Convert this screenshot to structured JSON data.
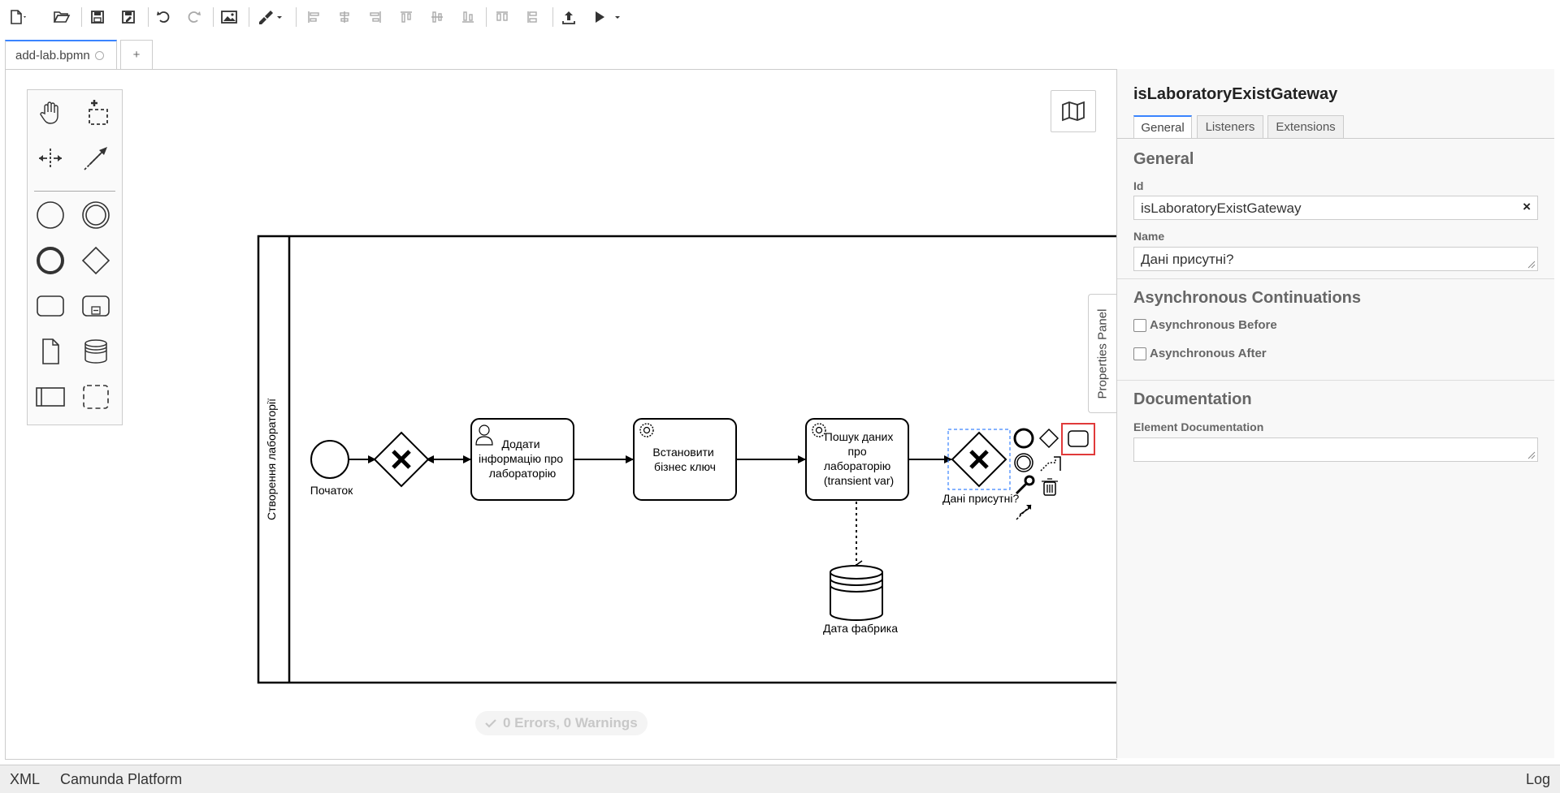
{
  "tabs": {
    "file_tab": "add-lab.bpmn",
    "add_tab": "+"
  },
  "diagram": {
    "pool_label": "Створення лабораторії",
    "start_event": "Початок",
    "task1": [
      "Додати",
      "інформацію про",
      "лабораторію"
    ],
    "task2": [
      "Встановити",
      "бізнес ключ"
    ],
    "task3": [
      "Пошук даних",
      "про",
      "лабораторію",
      "(transient var)"
    ],
    "gateway2": "Дані присутні?",
    "data_store": "Дата фабрика"
  },
  "status": {
    "text": "0 Errors, 0 Warnings"
  },
  "properties_toggle": "Properties Panel",
  "panel": {
    "title": "isLaboratoryExistGateway",
    "tabs": [
      "General",
      "Listeners",
      "Extensions"
    ],
    "general_section": "General",
    "id_label": "Id",
    "id_value": "isLaboratoryExistGateway",
    "clear_symbol": "×",
    "name_label": "Name",
    "name_value": "Дані присутні?",
    "async_section": "Asynchronous Continuations",
    "async_before": "Asynchronous Before",
    "async_after": "Asynchronous After",
    "doc_section": "Documentation",
    "doc_label": "Element Documentation",
    "doc_value": ""
  },
  "bottombar": {
    "xml": "XML",
    "platform": "Camunda Platform",
    "log": "Log"
  },
  "colors": {
    "accent": "#3a84ff",
    "selection": "#e03a3a"
  }
}
